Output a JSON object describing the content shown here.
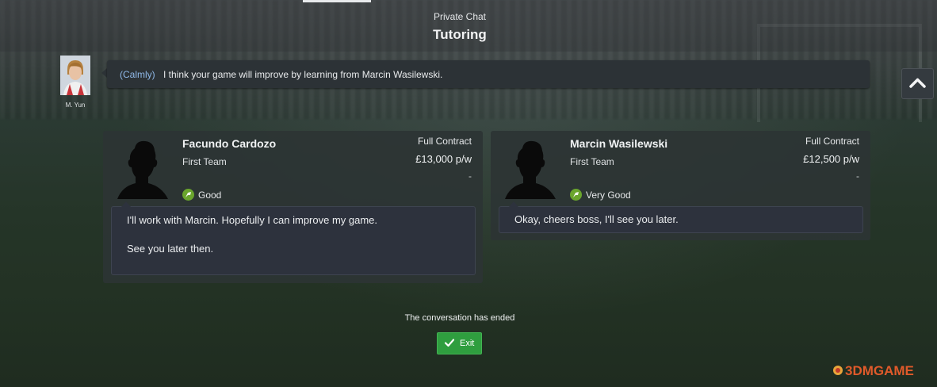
{
  "header": {
    "subtitle": "Private Chat",
    "title": "Tutoring"
  },
  "coach": {
    "name": "M. Yun",
    "tone": "(Calmly)",
    "message": "I think your game will improve by learning from Marcin Wasilewski."
  },
  "players": [
    {
      "name": "Facundo Cardozo",
      "squad": "First Team",
      "contract": "Full Contract",
      "wage": "£13,000 p/w",
      "extra": "-",
      "reaction": "Good",
      "reply_lines": [
        "I'll work with Marcin. Hopefully I can improve my game.",
        "See you later then."
      ]
    },
    {
      "name": "Marcin Wasilewski",
      "squad": "First Team",
      "contract": "Full Contract",
      "wage": "£12,500 p/w",
      "extra": "-",
      "reaction": "Very Good",
      "reply_lines": [
        "Okay, cheers boss, I'll see you later."
      ]
    }
  ],
  "footer": {
    "status": "The conversation has ended",
    "exit_label": "Exit"
  },
  "icons": {
    "scroll": "chevron-up-icon",
    "reaction": "arrow-icon",
    "exit": "checkmark-icon"
  },
  "colors": {
    "accent_green": "#2f9e3f",
    "reaction_green": "#6aa52d",
    "tone_blue": "#8fb8e8"
  },
  "watermark": {
    "line1": "3DMGAME",
    "logo": "3DMGAME"
  }
}
